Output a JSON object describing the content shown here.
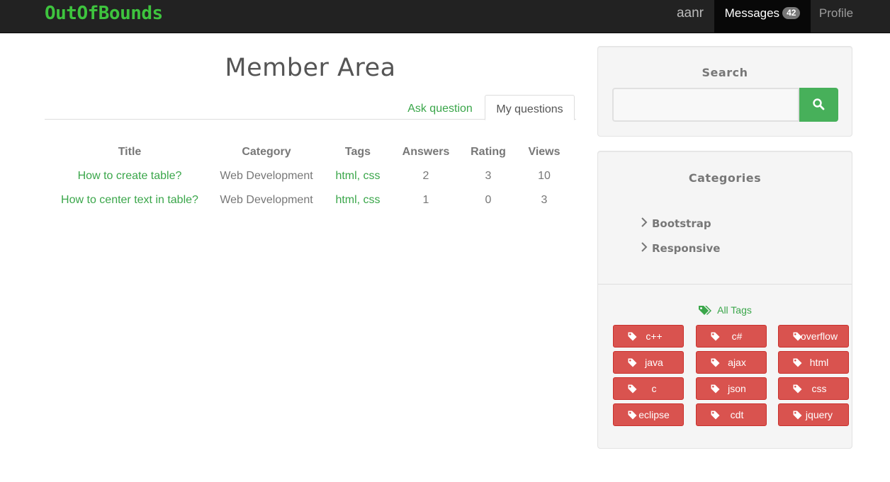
{
  "navbar": {
    "brand": "OutOfBounds",
    "user": "aanr",
    "messages_label": "Messages",
    "messages_count": "42",
    "profile_label": "Profile"
  },
  "main": {
    "title": "Member Area",
    "tabs": [
      {
        "label": "Ask question",
        "active": false
      },
      {
        "label": "My questions",
        "active": true
      }
    ],
    "table": {
      "headers": [
        "Title",
        "Category",
        "Tags",
        "Answers",
        "Rating",
        "Views"
      ],
      "rows": [
        {
          "title": "How to create table?",
          "category": "Web Development",
          "tags": "html, css",
          "answers": "2",
          "rating": "3",
          "views": "10"
        },
        {
          "title": "How to center text in table?",
          "category": "Web Development",
          "tags": "html, css",
          "answers": "1",
          "rating": "0",
          "views": "3"
        }
      ]
    }
  },
  "sidebar": {
    "search": {
      "heading": "Search",
      "value": "",
      "button_icon": "search-icon"
    },
    "categories": {
      "heading": "Categories",
      "items": [
        "Bootstrap",
        "Responsive"
      ]
    },
    "tags": {
      "all_label": "All Tags",
      "items": [
        "c++",
        "c#",
        "overflow",
        "java",
        "ajax",
        "html",
        "c",
        "json",
        "css",
        "eclipse",
        "cdt",
        "jquery"
      ]
    }
  },
  "colors": {
    "brand": "#3ec43e",
    "link": "#3aa64a",
    "search_button": "#47b05a",
    "tag_button": "#d9534f",
    "navbar": "#222222"
  }
}
